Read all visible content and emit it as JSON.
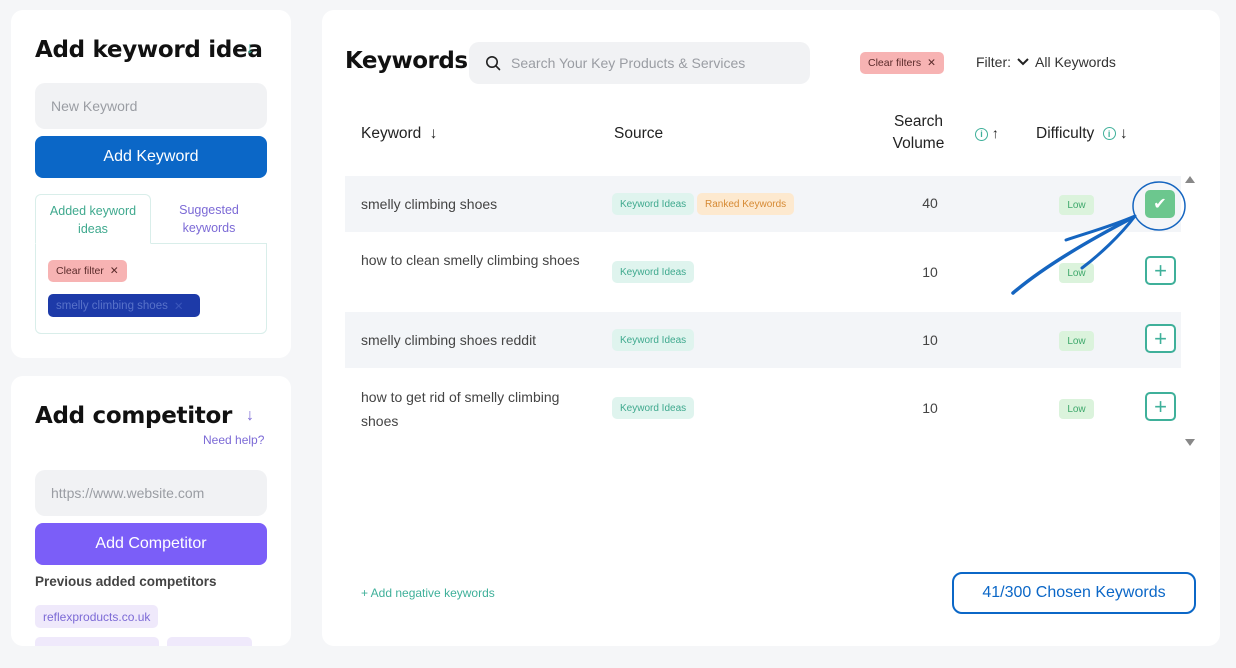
{
  "keyword_panel": {
    "title": "Add keyword idea",
    "input_placeholder": "New Keyword",
    "add_button": "Add Keyword",
    "tab_added": "Added keyword ideas",
    "tab_suggested": "Suggested keywords",
    "clear_filter": "Clear filter",
    "active_keyword_chip": "smelly climbing shoes"
  },
  "competitor_panel": {
    "title": "Add competitor",
    "help_link": "Need help?",
    "input_placeholder": "https://www.website.com",
    "add_button": "Add Competitor",
    "previous_label": "Previous added competitors",
    "previous": [
      "reflexproducts.co.uk"
    ]
  },
  "main": {
    "title": "Keywords",
    "search_placeholder": "Search Your Key Products & Services",
    "clear_filters": "Clear filters",
    "filter_label": "Filter:",
    "filter_value": "All Keywords",
    "columns": {
      "keyword": "Keyword",
      "source": "Source",
      "search_volume_line1": "Search",
      "search_volume_line2": "Volume",
      "difficulty": "Difficulty"
    },
    "rows": [
      {
        "keyword": "smelly climbing shoes",
        "sources": [
          "Keyword Ideas",
          "Ranked Keywords"
        ],
        "volume": "40",
        "difficulty": "Low",
        "selected": true
      },
      {
        "keyword": "how to clean smelly climbing shoes",
        "sources": [
          "Keyword Ideas"
        ],
        "volume": "10",
        "difficulty": "Low",
        "selected": false
      },
      {
        "keyword": "smelly climbing shoes reddit",
        "sources": [
          "Keyword Ideas"
        ],
        "volume": "10",
        "difficulty": "Low",
        "selected": false
      },
      {
        "keyword": "how to get rid of smelly climbing shoes",
        "sources": [
          "Keyword Ideas"
        ],
        "volume": "10",
        "difficulty": "Low",
        "selected": false
      }
    ],
    "add_negative": "+ Add negative keywords",
    "chosen_counter": "41/300 Chosen Keywords"
  },
  "colors": {
    "primary_blue": "#0b67c7",
    "purple": "#7b5ef8",
    "teal": "#3fb09a",
    "annotation_arrow": "#1565c0"
  }
}
